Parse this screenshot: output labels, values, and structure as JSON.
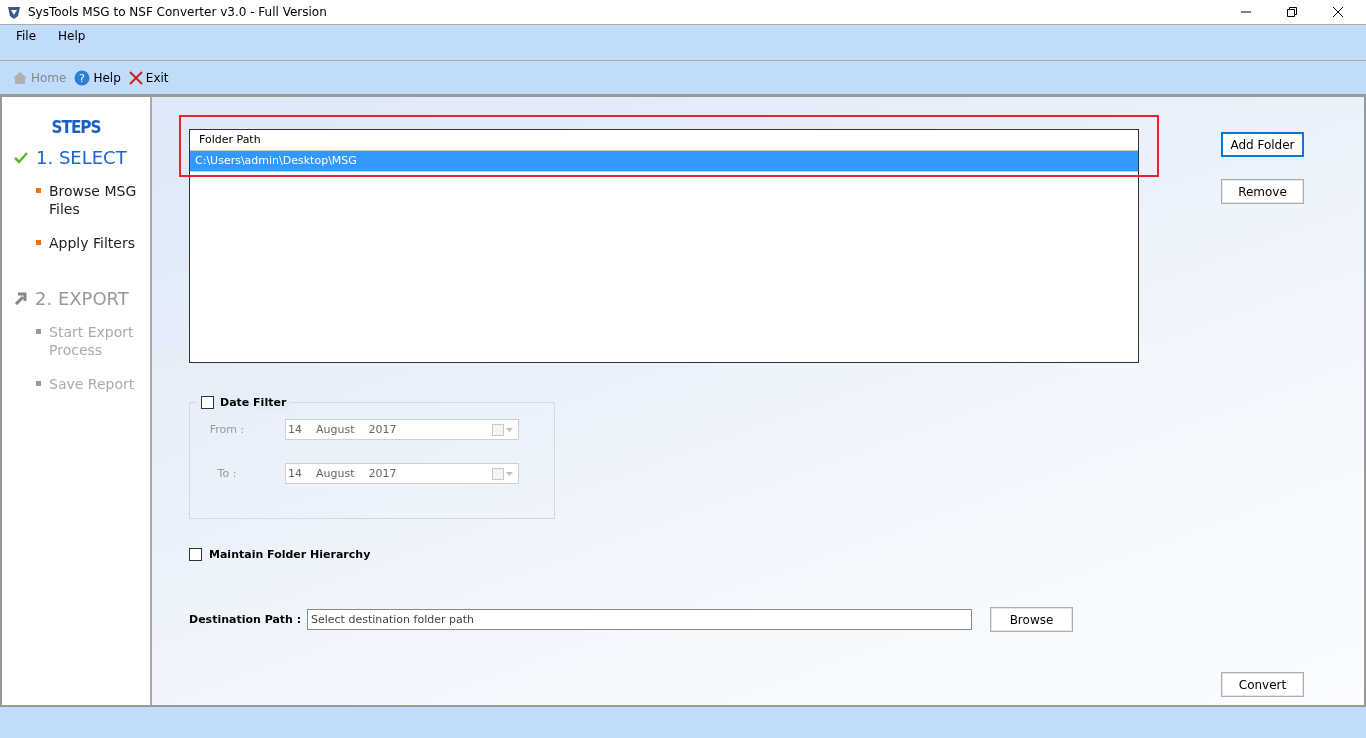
{
  "window": {
    "title": "SysTools MSG to NSF Converter v3.0 - Full Version"
  },
  "menu": [
    "File",
    "Help"
  ],
  "toolbar": [
    {
      "kind": "home",
      "label": "Home",
      "disabled": true
    },
    {
      "kind": "help",
      "label": "Help",
      "disabled": false,
      "glyph": "?"
    },
    {
      "kind": "exit",
      "label": "Exit",
      "disabled": false
    }
  ],
  "steps": {
    "title": "STEPS",
    "items": [
      {
        "kind": "select",
        "label": "1. SELECT",
        "active": true,
        "substeps": [
          "Browse MSG Files",
          "Apply Filters"
        ]
      },
      {
        "kind": "export",
        "label": "2. EXPORT",
        "active": false,
        "substeps": [
          "Start Export Process",
          "Save Report"
        ]
      }
    ]
  },
  "folder_table": {
    "columns": [
      "Folder Path"
    ],
    "rows": [
      {
        "path": "C:\\Users\\admin\\Desktop\\MSG",
        "selected": true
      }
    ]
  },
  "side_buttons": [
    {
      "label": "Add Folder",
      "focused": true
    },
    {
      "label": "Remove",
      "focused": false
    }
  ],
  "date_filter": {
    "label": "Date Filter",
    "checked": false,
    "from_label": "From :",
    "from_value": "14    August    2017",
    "to_label": "To :",
    "to_value": "14    August    2017"
  },
  "hierarchy": {
    "label": "Maintain Folder Hierarchy",
    "checked": false
  },
  "destination": {
    "label": "Destination Path  :",
    "placeholder": "Select destination folder path",
    "button": "Browse"
  },
  "convert_button": "Convert"
}
